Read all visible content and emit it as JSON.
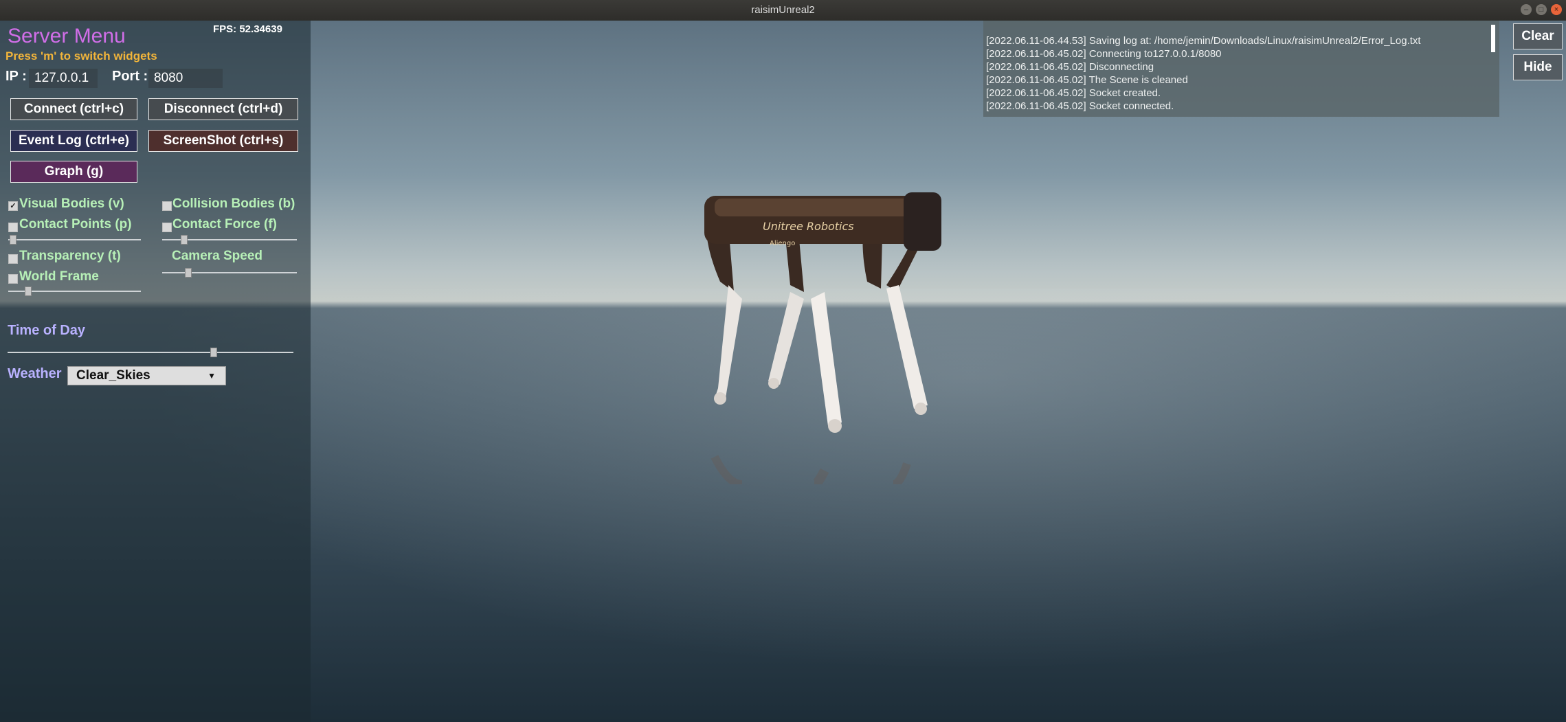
{
  "window": {
    "title": "raisimUnreal2"
  },
  "panel": {
    "title": "Server Menu",
    "fps_label": "FPS:",
    "fps_value": "52.34639",
    "hint": "Press 'm' to switch widgets",
    "ip_label": "IP :",
    "ip_value": "127.0.0.1",
    "port_label": "Port :",
    "port_value": "8080",
    "buttons": {
      "connect": "Connect (ctrl+c)",
      "disconnect": "Disconnect (ctrl+d)",
      "event_log": "Event Log (ctrl+e)",
      "screenshot": "ScreenShot (ctrl+s)",
      "graph": "Graph (g)"
    },
    "toggles": {
      "visual_bodies": {
        "label": "Visual Bodies (v)",
        "checked": true
      },
      "collision_bodies": {
        "label": "Collision Bodies (b)",
        "checked": false
      },
      "contact_points": {
        "label": "Contact Points (p)",
        "checked": false
      },
      "contact_force": {
        "label": "Contact Force (f)",
        "checked": false
      },
      "transparency": {
        "label": "Transparency (t)",
        "checked": false
      },
      "world_frame": {
        "label": "World Frame",
        "checked": false
      }
    },
    "camera_speed_label": "Camera Speed",
    "time_of_day_label": "Time of Day",
    "weather_label": "Weather",
    "weather_value": "Clear_Skies",
    "sliders": {
      "contact_points": 0.02,
      "contact_force": 0.15,
      "camera_speed": 0.18,
      "world_frame": 0.15,
      "time_of_day": 0.72
    }
  },
  "log": {
    "lines": [
      "[2022.06.11-06.44.53] Saving log at: /home/jemin/Downloads/Linux/raisimUnreal2/Error_Log.txt",
      "[2022.06.11-06.45.02] Connecting to127.0.0.1/8080",
      "[2022.06.11-06.45.02] Disconnecting",
      "[2022.06.11-06.45.02] The Scene is cleaned",
      "[2022.06.11-06.45.02] Socket created.",
      "[2022.06.11-06.45.02] Socket connected."
    ]
  },
  "right_buttons": {
    "clear": "Clear",
    "hide": "Hide"
  },
  "robot": {
    "brand": "Unitree Robotics",
    "model": "Aliengo"
  },
  "icons": {
    "checkbox_checked": "check-icon",
    "dropdown": "chevron-down-icon"
  }
}
